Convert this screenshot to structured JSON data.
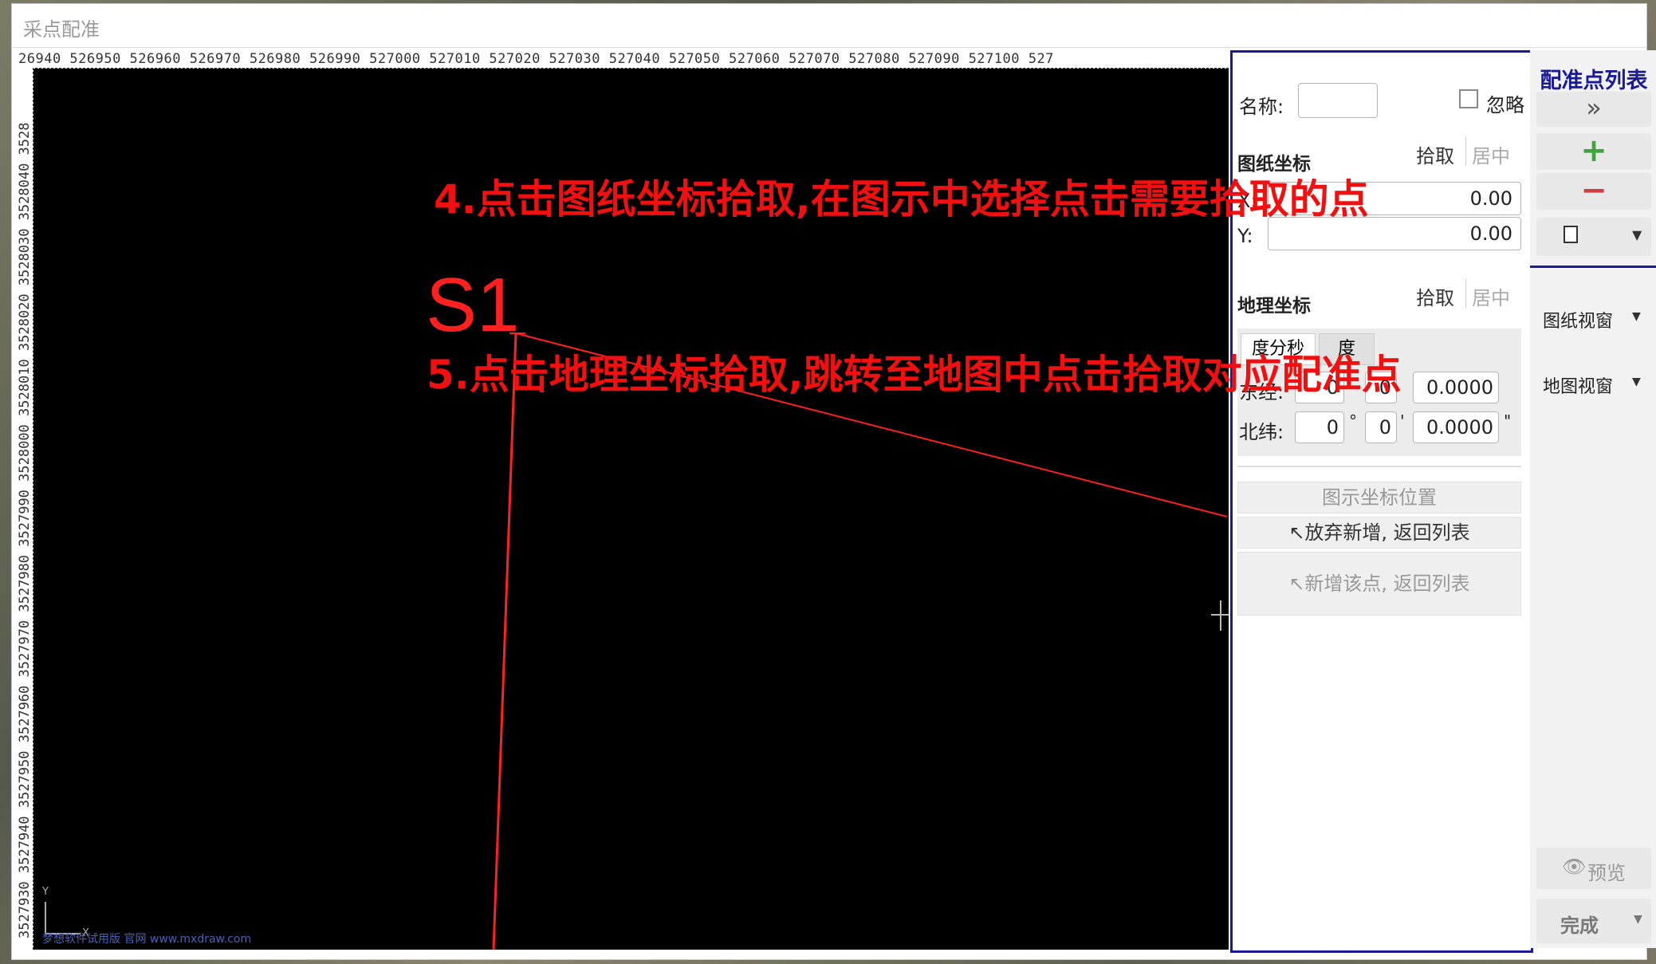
{
  "window": {
    "title": "采点配准"
  },
  "cad": {
    "ruler_top": "26940 526950 526960 526970 526980 526990 527000 527010 527020 527030 527040 527050 527060 527070 527080 527090 527100 527",
    "ruler_left": "3527930 3527940 3527950 3527960 3527970 3527980 3527990 3528000 3528010 3528020 3528030 3528040 3528",
    "point_label": "S1",
    "watermark": "梦想软件试用版 官网 www.mxdraw.com",
    "axis_y": "Y",
    "axis_x": "X"
  },
  "form": {
    "name_label": "名称:",
    "name_value": "",
    "ignore_label": "忽略",
    "ignore_checked": false,
    "paper_section": "图纸坐标",
    "pick_label": "拾取",
    "center_label": "居中",
    "x_label": "X:",
    "x_value": "0.00",
    "y_label": "Y:",
    "y_value": "0.00",
    "geo_section": "地理坐标",
    "tab_dms": "度分秒",
    "tab_deg": "度",
    "lon_label": "东经:",
    "lon_d": "0",
    "lon_m": "0",
    "lon_s": "0.0000",
    "lat_label": "北纬:",
    "lat_d": "0",
    "lat_m": "0",
    "lat_s": "0.0000",
    "deg_mark": "°",
    "min_mark": "'",
    "sec_mark": "\"",
    "locate_btn": "图示坐标位置",
    "discard_btn": "↖放弃新增, 返回列表",
    "add_btn": "↖新增该点, 返回列表"
  },
  "list_panel": {
    "title": "配准点列表",
    "expand_icon": "»",
    "add_icon": "+",
    "remove_icon": "−",
    "paper_view": "图纸视窗",
    "map_view": "地图视窗",
    "preview": "预览",
    "finish": "完成"
  },
  "annotations": {
    "step4": "4.点击图纸坐标拾取,在图示中选择点击需要拾取的点",
    "step5": "5.点击地理坐标拾取,跳转至地图中点击拾取对应配准点"
  },
  "colors": {
    "annotation": "#f01010",
    "panel_border": "#1a1a99",
    "cad_line": "#ff2020"
  }
}
